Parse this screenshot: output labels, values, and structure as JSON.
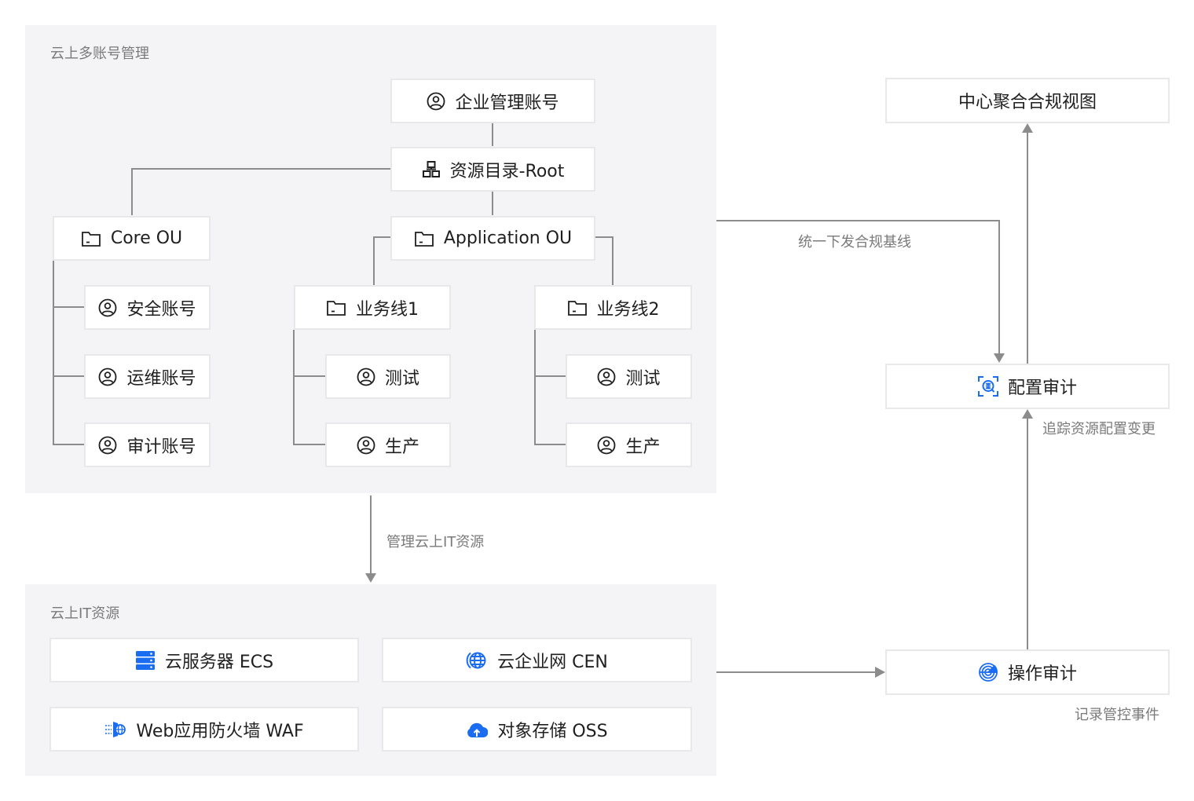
{
  "panels": {
    "multi_account": {
      "title": "云上多账号管理"
    },
    "it_resources": {
      "title": "云上IT资源"
    }
  },
  "org_tree": {
    "management_account": {
      "label": "企业管理账号",
      "icon": "user-circle-icon"
    },
    "root": {
      "label": "资源目录-Root",
      "icon": "org-tree-icon"
    },
    "core_ou": {
      "label": "Core OU",
      "icon": "folder-icon",
      "accounts": [
        {
          "label": "安全账号",
          "icon": "user-circle-icon"
        },
        {
          "label": "运维账号",
          "icon": "user-circle-icon"
        },
        {
          "label": "审计账号",
          "icon": "user-circle-icon"
        }
      ]
    },
    "application_ou": {
      "label": "Application OU",
      "icon": "folder-icon",
      "business_lines": [
        {
          "label": "业务线1",
          "icon": "folder-icon",
          "accounts": [
            {
              "label": "测试",
              "icon": "user-circle-icon"
            },
            {
              "label": "生产",
              "icon": "user-circle-icon"
            }
          ]
        },
        {
          "label": "业务线2",
          "icon": "folder-icon",
          "accounts": [
            {
              "label": "测试",
              "icon": "user-circle-icon"
            },
            {
              "label": "生产",
              "icon": "user-circle-icon"
            }
          ]
        }
      ]
    }
  },
  "resources": [
    {
      "label": "云服务器 ECS",
      "icon": "server-icon"
    },
    {
      "label": "云企业网 CEN",
      "icon": "globe-network-icon"
    },
    {
      "label": "Web应用防火墙 WAF",
      "icon": "firewall-icon"
    },
    {
      "label": "对象存储 OSS",
      "icon": "cloud-upload-icon"
    }
  ],
  "compliance": {
    "central_view": {
      "label": "中心聚合合规视图"
    },
    "config_audit": {
      "label": "配置审计",
      "icon": "config-audit-icon"
    },
    "action_audit": {
      "label": "操作审计",
      "icon": "radar-icon"
    }
  },
  "edge_labels": {
    "baseline": "统一下发合规基线",
    "manage_it": "管理云上IT资源",
    "track_changes": "追踪资源配置变更",
    "record_events": "记录管控事件"
  },
  "colors": {
    "accent": "#1a6cf0",
    "connector": "#8c8c8c",
    "panel_bg": "#f4f4f6",
    "node_border": "#e8e8ea"
  }
}
